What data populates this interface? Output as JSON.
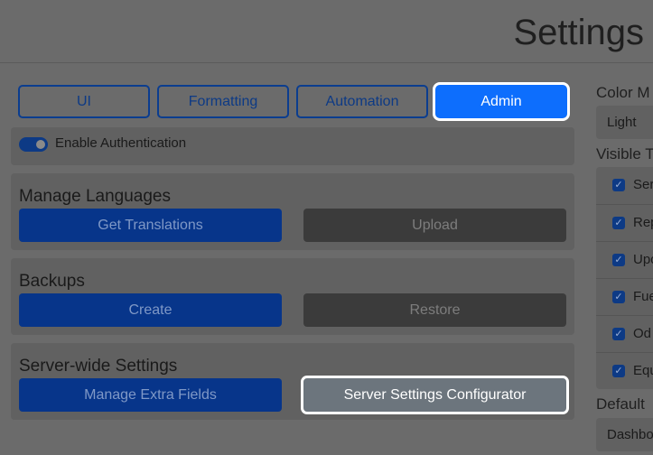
{
  "header": {
    "title": "Settings"
  },
  "tabs": [
    {
      "label": "UI"
    },
    {
      "label": "Formatting"
    },
    {
      "label": "Automation"
    },
    {
      "label": "Admin"
    }
  ],
  "auth": {
    "label": "Enable Authentication",
    "enabled": true
  },
  "languages": {
    "title": "Manage Languages",
    "primary": "Get Translations",
    "secondary": "Upload"
  },
  "backups": {
    "title": "Backups",
    "primary": "Create",
    "secondary": "Restore"
  },
  "server": {
    "title": "Server-wide Settings",
    "primary": "Manage Extra Fields",
    "secondary": "Server Settings Configurator"
  },
  "right": {
    "color_mode_label": "Color M",
    "color_mode_value": "Light",
    "visible_label": "Visible T",
    "visible_items": [
      "Ser",
      "Rep",
      "Upc",
      "Fue",
      "Od",
      "Equ"
    ],
    "default_label": "Default",
    "default_value": "Dashbo"
  }
}
